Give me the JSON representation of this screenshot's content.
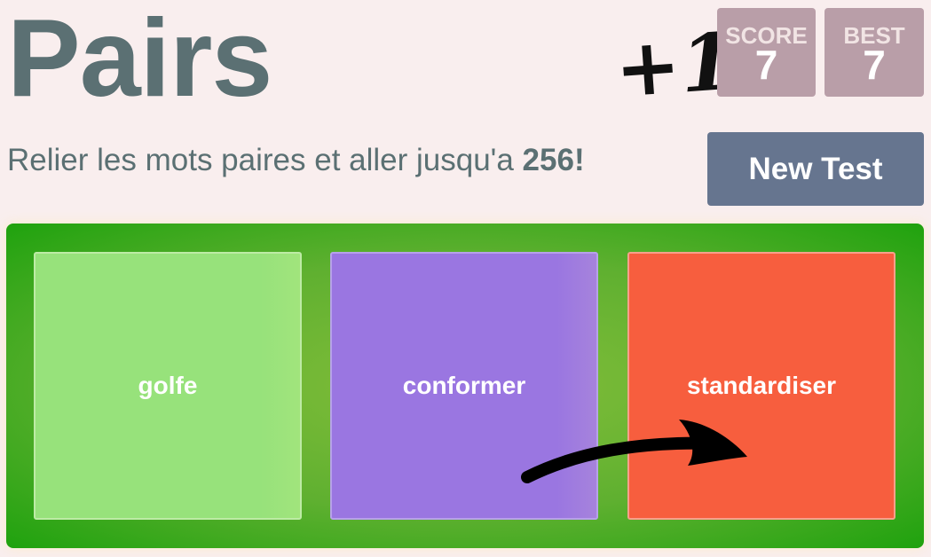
{
  "header": {
    "title": "Pairs",
    "bonus": "+1",
    "score_label": "SCORE",
    "score_value": "7",
    "best_label": "BEST",
    "best_value": "7"
  },
  "intro": {
    "text": "Relier les mots paires et aller jusqu'a ",
    "target": "256!"
  },
  "controls": {
    "new_test_label": "New Test"
  },
  "board": {
    "tiles": [
      {
        "word": "golfe",
        "color": "#97e27b"
      },
      {
        "word": "conformer",
        "color": "#9a76e1"
      },
      {
        "word": "standardiser",
        "color": "#f75e3e"
      }
    ],
    "background_color": "#5fb030"
  },
  "annotation": {
    "icon": "hand-drawn-arrow-icon"
  }
}
